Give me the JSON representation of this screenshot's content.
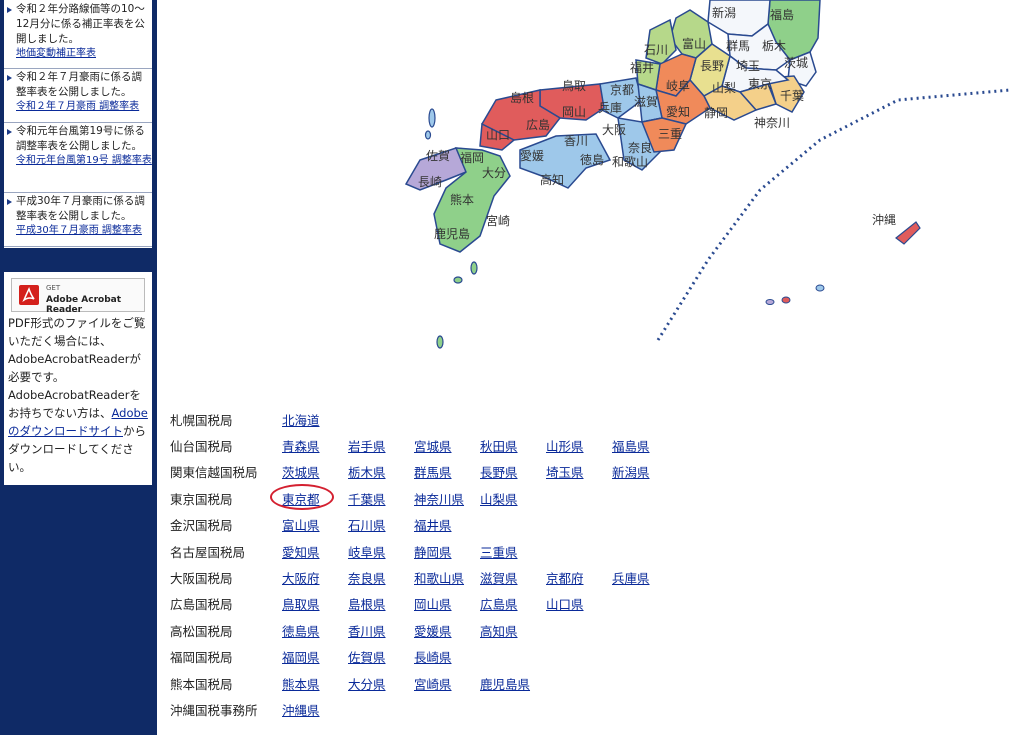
{
  "news": [
    {
      "text": "令和２年分路線価等の10～12月分に係る補正率表を公開しました。",
      "link": "地価変動補正率表"
    },
    {
      "text": "令和２年７月豪雨に係る調整率表を公開しました。",
      "link": "令和２年７月豪雨 調整率表"
    },
    {
      "text": "令和元年台風第19号に係る調整率表を公開しました。",
      "link": "令和元年台風第19号 調整率表"
    },
    {
      "text": "平成30年７月豪雨に係る調整率表を公開しました。",
      "link": "平成30年７月豪雨 調整率表"
    }
  ],
  "adobe": {
    "badge_get": "GET",
    "badge_name": "Adobe Acrobat Reader",
    "text_before": "PDF形式のファイルをご覧いただく場合には、AdobeAcrobatReaderが必要です。AdobeAcrobatReaderをお持ちでない方は、",
    "link": "Adobeのダウンロードサイト",
    "text_after": "からダウンロードしてください。"
  },
  "map_labels": {
    "niigata": "新潟",
    "fukushima": "福島",
    "ishikawa": "石川",
    "toyama": "富山",
    "gunma": "群馬",
    "tochigi": "栃木",
    "ibaraki": "茨城",
    "fukui": "福井",
    "nagano": "長野",
    "saitama": "埼玉",
    "tottori": "鳥取",
    "shimane": "島根",
    "kyoto": "京都",
    "gifu": "岐阜",
    "yamanashi": "山梨",
    "tokyo": "東京",
    "chiba": "千葉",
    "okayama": "岡山",
    "hyogo": "兵庫",
    "shiga": "滋賀",
    "aichi": "愛知",
    "shizuoka": "静岡",
    "hiroshima": "広島",
    "yamaguchi": "山口",
    "osaka": "大阪",
    "mie": "三重",
    "kanagawa": "神奈川",
    "kagawa": "香川",
    "saga": "佐賀",
    "fukuoka": "福岡",
    "ehime": "愛媛",
    "nara": "奈良",
    "tokushima": "徳島",
    "wakayama": "和歌山",
    "oita": "大分",
    "nagasaki": "長崎",
    "kochi": "高知",
    "kumamoto": "熊本",
    "miyazaki": "宮崎",
    "kagoshima": "鹿児島",
    "okinawa": "沖縄"
  },
  "offices": [
    {
      "name": "札幌国税局",
      "prefs": [
        "北海道"
      ]
    },
    {
      "name": "仙台国税局",
      "prefs": [
        "青森県",
        "岩手県",
        "宮城県",
        "秋田県",
        "山形県",
        "福島県"
      ]
    },
    {
      "name": "関東信越国税局",
      "prefs": [
        "茨城県",
        "栃木県",
        "群馬県",
        "長野県",
        "埼玉県",
        "新潟県"
      ]
    },
    {
      "name": "東京国税局",
      "prefs": [
        "東京都",
        "千葉県",
        "神奈川県",
        "山梨県"
      ]
    },
    {
      "name": "金沢国税局",
      "prefs": [
        "富山県",
        "石川県",
        "福井県"
      ]
    },
    {
      "name": "名古屋国税局",
      "prefs": [
        "愛知県",
        "岐阜県",
        "静岡県",
        "三重県"
      ]
    },
    {
      "name": "大阪国税局",
      "prefs": [
        "大阪府",
        "奈良県",
        "和歌山県",
        "滋賀県",
        "京都府",
        "兵庫県"
      ]
    },
    {
      "name": "広島国税局",
      "prefs": [
        "鳥取県",
        "島根県",
        "岡山県",
        "広島県",
        "山口県"
      ]
    },
    {
      "name": "高松国税局",
      "prefs": [
        "徳島県",
        "香川県",
        "愛媛県",
        "高知県"
      ]
    },
    {
      "name": "福岡国税局",
      "prefs": [
        "福岡県",
        "佐賀県",
        "長崎県"
      ]
    },
    {
      "name": "熊本国税局",
      "prefs": [
        "熊本県",
        "大分県",
        "宮崎県",
        "鹿児島県"
      ]
    },
    {
      "name": "沖縄国税事務所",
      "prefs": [
        "沖縄県"
      ]
    }
  ],
  "colors": {
    "sidebar": "#0f2a66",
    "link": "#0a2a99",
    "highlight": "#d42030"
  }
}
